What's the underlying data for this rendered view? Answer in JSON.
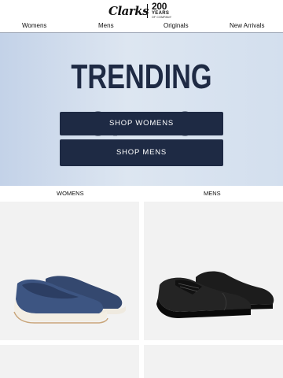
{
  "header": {
    "brand": "Clarks",
    "anniversary": {
      "number": "200",
      "word": "YEARS",
      "sub": "OF COMPANY"
    }
  },
  "nav": {
    "items": [
      {
        "label": "Womens"
      },
      {
        "label": "Mens"
      },
      {
        "label": "Originals"
      },
      {
        "label": "New Arrivals"
      }
    ]
  },
  "hero": {
    "title": "TRENDING STYLES",
    "cta_womens": "SHOP WOMENS",
    "cta_mens": "SHOP MENS",
    "background_color": "#c3d2e8",
    "button_color": "#1e2a44"
  },
  "products": {
    "womens_label": "WOMENS",
    "mens_label": "MENS",
    "womens_icon": "blue-knit-slip-on-shoe",
    "mens_icon": "black-leather-oxford-shoe"
  }
}
